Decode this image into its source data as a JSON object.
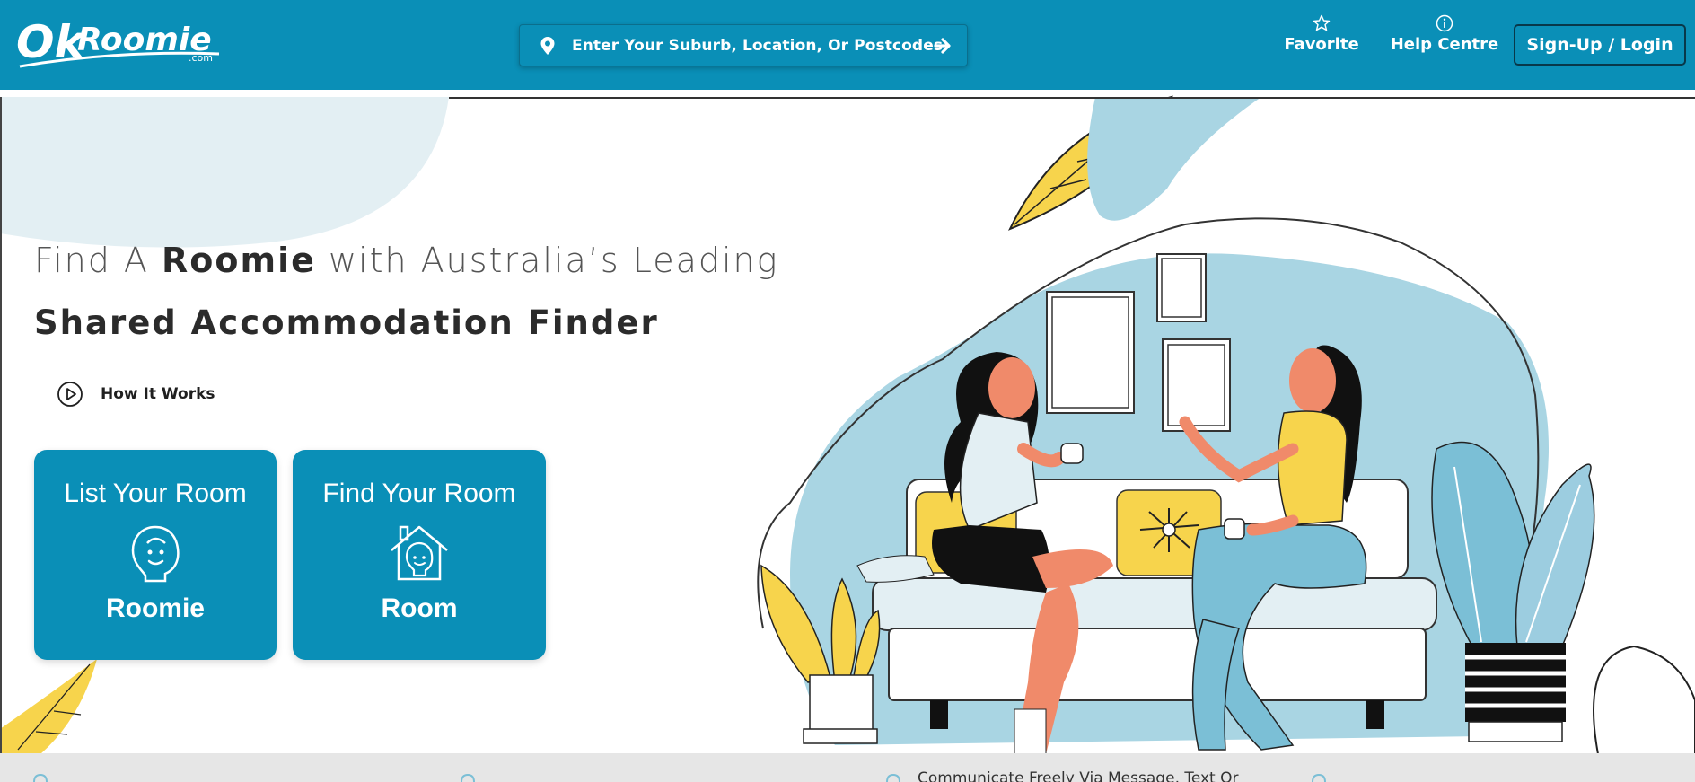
{
  "brand": {
    "logo_text": "OkRoomie",
    "logo_sub": ".com",
    "primary_color": "#0a8fb7",
    "accent_yellow": "#f7d44c",
    "accent_blue": "#7bbfd6"
  },
  "header": {
    "search_placeholder": "Enter Your Suburb, Location, Or Postcodes",
    "search_icon": "map-pin-icon",
    "search_submit_icon": "arrow-right-icon",
    "nav": [
      {
        "label": "Favorite",
        "icon": "star-icon"
      },
      {
        "label": "Help Centre",
        "icon": "info-icon"
      }
    ],
    "signup_label": "Sign-Up / Login"
  },
  "hero": {
    "headline_prefix": "Find A ",
    "headline_bold": "Roomie",
    "headline_suffix": " with Australia’s Leading",
    "subheadline": "Shared Accommodation Finder",
    "how_it_works": "How It Works",
    "cards": [
      {
        "title": "List Your Room",
        "label": "Roomie",
        "icon": "roomie-face-icon"
      },
      {
        "title": "Find Your Room",
        "label": "Room",
        "icon": "house-roomie-icon"
      }
    ]
  },
  "strip": {
    "partial_text": "Communicate Freely Via Message, Text Or"
  }
}
